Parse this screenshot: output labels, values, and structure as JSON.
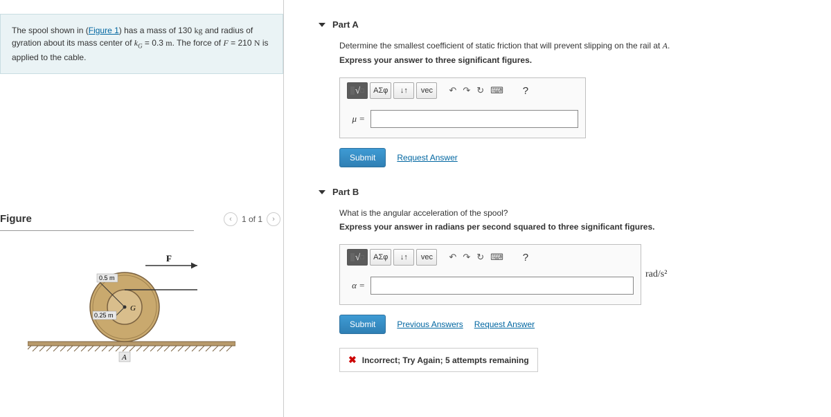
{
  "problem": {
    "pre_link": "The spool shown in (",
    "link": "Figure 1",
    "post_link": ") has a mass of 130 ",
    "mass_unit": "kg",
    "text2": " and radius of gyration about its mass center of ",
    "kg_sym": "k",
    "kg_sub": "G",
    "kg_eq": " = 0.3 ",
    "kg_unit": "m",
    "text3": ". The force of ",
    "F_sym": "F",
    "F_eq": " = 210 ",
    "F_unit": "N",
    "text4": " is applied to the cable."
  },
  "figure": {
    "title": "Figure",
    "counter": "1 of 1",
    "r_outer": "0.5 m",
    "r_inner": "0.25 m",
    "G": "G",
    "A": "A",
    "F": "F"
  },
  "partA": {
    "title": "Part A",
    "question": "Determine the smallest coefficient of static friction that will prevent slipping on the rail at A.",
    "instruction": "Express your answer to three significant figures.",
    "var": "μ =",
    "submit": "Submit",
    "request": "Request Answer"
  },
  "partB": {
    "title": "Part B",
    "question": "What is the angular acceleration of the spool?",
    "instruction": "Express your answer in radians per second squared to three significant figures.",
    "var": "α =",
    "units": "rad/s²",
    "submit": "Submit",
    "previous": "Previous Answers",
    "request": "Request Answer",
    "feedback": "Incorrect; Try Again; 5 attempts remaining"
  },
  "toolbar": {
    "templates": "▮√▯",
    "greek": "ΑΣφ",
    "subsup": "↓↑",
    "vec": "vec",
    "undo_g": "↶",
    "redo_g": "↷",
    "reset_g": "↻",
    "keyboard": "⌨",
    "help": "?"
  }
}
